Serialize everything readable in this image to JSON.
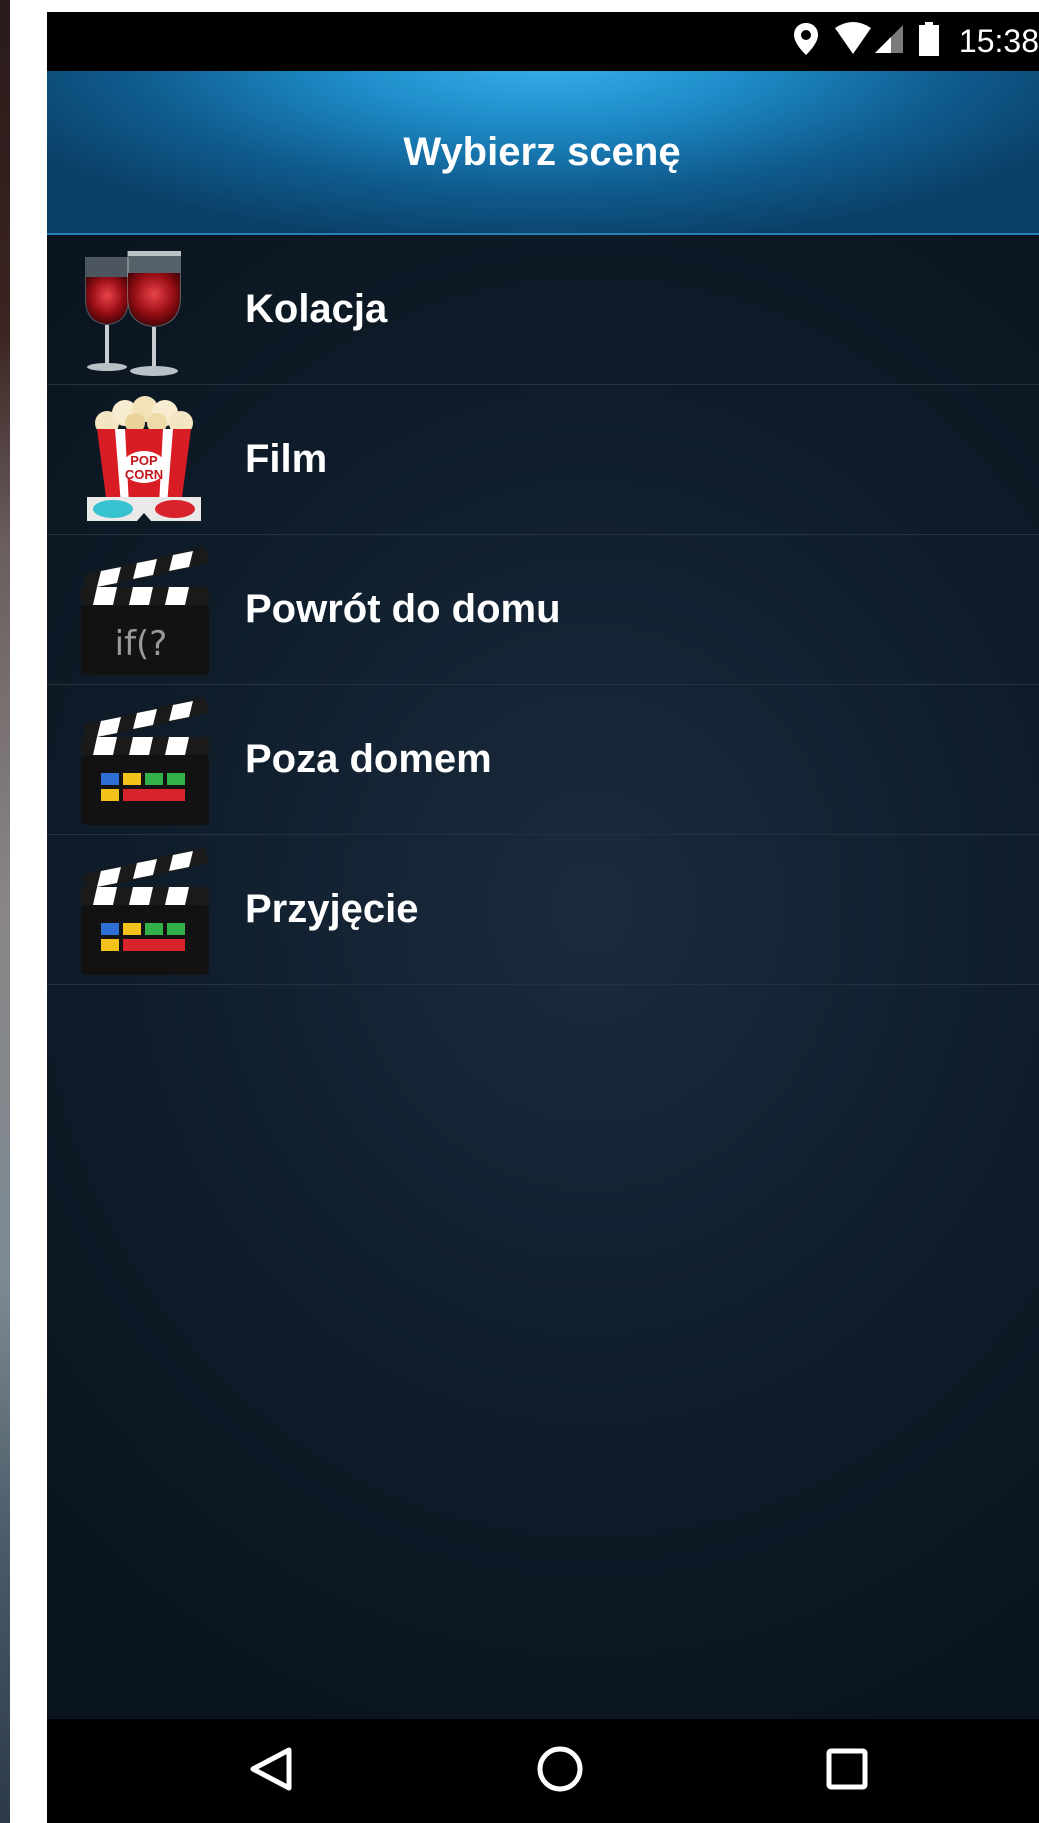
{
  "status_bar": {
    "time": "15:38",
    "icons": [
      "location-icon",
      "wifi-icon",
      "signal-icon",
      "battery-icon"
    ]
  },
  "header": {
    "title": "Wybierz scenę"
  },
  "scenes": [
    {
      "label": "Kolacja",
      "icon": "wine-glasses-icon"
    },
    {
      "label": "Film",
      "icon": "popcorn-icon"
    },
    {
      "label": "Powrót do domu",
      "icon": "clapperboard-script-icon"
    },
    {
      "label": "Poza domem",
      "icon": "clapperboard-icon"
    },
    {
      "label": "Przyjęcie",
      "icon": "clapperboard-icon"
    }
  ],
  "nav_bar": {
    "buttons": [
      "back-icon",
      "home-icon",
      "recents-icon"
    ]
  },
  "colors": {
    "header_accent": "#1e8cc8",
    "background": "#0b1520",
    "text": "#ffffff"
  }
}
